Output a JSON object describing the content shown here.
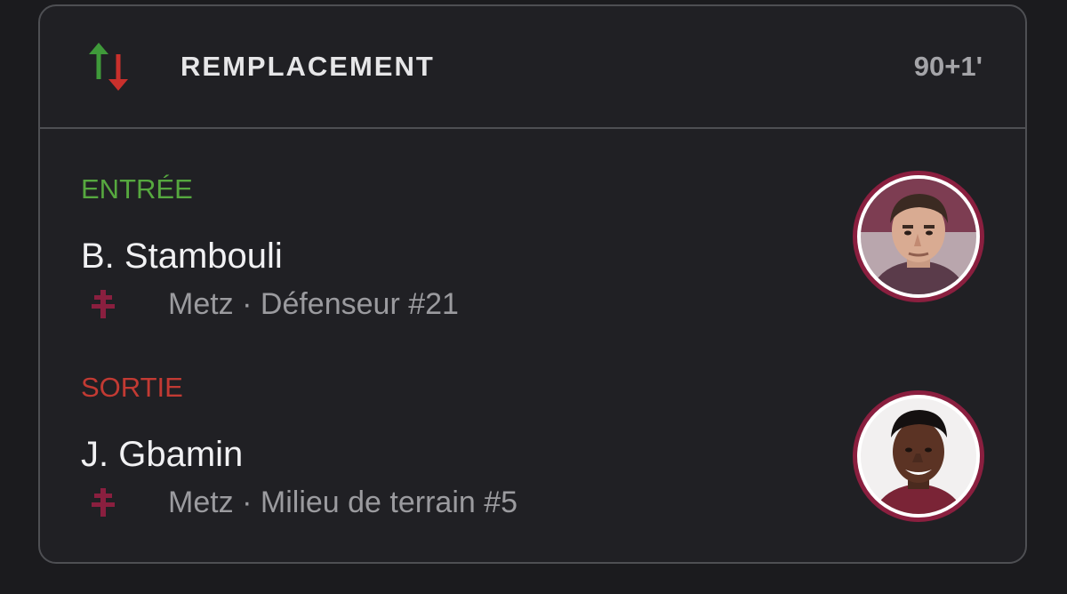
{
  "event": {
    "title": "REMPLACEMENT",
    "minute": "90+1'",
    "icon": "substitution-arrows-icon",
    "colors": {
      "in": "#56a83f",
      "out": "#c23a33",
      "club": "#8a1f3f"
    }
  },
  "player_in": {
    "label": "ENTRÉE",
    "name": "B. Stambouli",
    "details": "Metz · Défenseur #21",
    "club_icon": "metz-cross-icon"
  },
  "player_out": {
    "label": "SORTIE",
    "name": "J. Gbamin",
    "details": "Metz · Milieu de terrain #5",
    "club_icon": "metz-cross-icon"
  }
}
